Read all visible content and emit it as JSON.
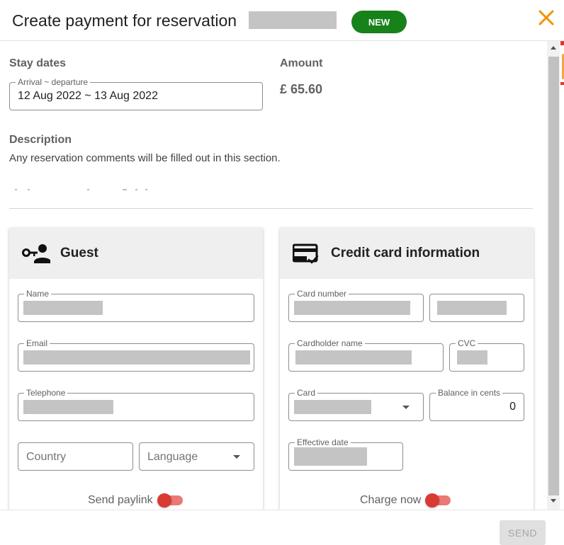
{
  "header": {
    "title": "Create payment for reservation",
    "badge": "NEW"
  },
  "stay": {
    "section_title": "Stay dates",
    "field_label": "Arrival ~ departure",
    "value": "12 Aug 2022 ~ 13 Aug 2022"
  },
  "amount": {
    "section_title": "Amount",
    "value": "£ 65.60"
  },
  "description": {
    "section_title": "Description",
    "text": "Any reservation comments will be filled out in this section."
  },
  "guest": {
    "title": "Guest",
    "name_label": "Name",
    "email_label": "Email",
    "telephone_label": "Telephone",
    "country_placeholder": "Country",
    "language_placeholder": "Language",
    "send_paylink_label": "Send paylink"
  },
  "card": {
    "title": "Credit card information",
    "card_number_label": "Card number",
    "cardholder_label": "Cardholder name",
    "cvc_label": "CVC",
    "card_label": "Card",
    "balance_label": "Balance in cents",
    "balance_value": "0",
    "effective_label": "Effective date",
    "charge_now_label": "Charge now"
  },
  "footer": {
    "send_label": "SEND"
  },
  "colors": {
    "badge": "#17811a",
    "close": "#f39200",
    "toggle": "#d93a31"
  },
  "icons": {
    "close": "close-icon",
    "guest": "guest-key-icon",
    "card": "credit-card-check-icon",
    "dropdown": "dropdown-arrow-icon"
  }
}
